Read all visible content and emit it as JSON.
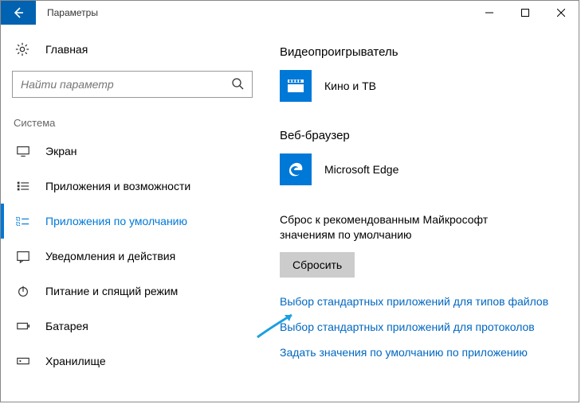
{
  "window": {
    "title": "Параметры"
  },
  "sidebar": {
    "home": "Главная",
    "search_placeholder": "Найти параметр",
    "group": "Система",
    "items": [
      {
        "label": "Экран"
      },
      {
        "label": "Приложения и возможности"
      },
      {
        "label": "Приложения по умолчанию"
      },
      {
        "label": "Уведомления и действия"
      },
      {
        "label": "Питание и спящий режим"
      },
      {
        "label": "Батарея"
      },
      {
        "label": "Хранилище"
      }
    ]
  },
  "main": {
    "sections": [
      {
        "title": "Видеопроигрыватель",
        "app": "Кино и ТВ"
      },
      {
        "title": "Веб-браузер",
        "app": "Microsoft Edge"
      }
    ],
    "reset": {
      "text": "Сброс к рекомендованным Майкрософт значениям по умолчанию",
      "button": "Сбросить"
    },
    "links": [
      "Выбор стандартных приложений для типов файлов",
      "Выбор стандартных приложений для протоколов",
      "Задать значения по умолчанию по приложению"
    ]
  }
}
